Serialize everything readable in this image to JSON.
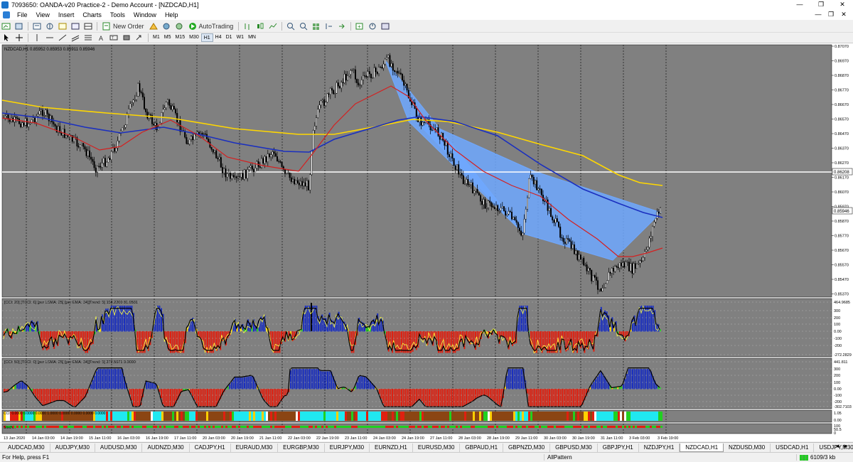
{
  "window": {
    "title": "7093650: OANDA-v20 Practice-2 - Demo Account - [NZDCAD,H1]",
    "controls": [
      "—",
      "❐",
      "✕"
    ]
  },
  "menu": {
    "items": [
      "File",
      "View",
      "Insert",
      "Charts",
      "Tools",
      "Window",
      "Help"
    ],
    "right_controls": [
      "—",
      "❐",
      "✕"
    ]
  },
  "toolbar": {
    "new_order": "New Order",
    "autotrading": "AutoTrading"
  },
  "timeframes": [
    "M1",
    "M5",
    "M15",
    "M30",
    "H1",
    "H4",
    "D1",
    "W1",
    "MN"
  ],
  "chart": {
    "header": "NZDCAD,H1  0.85952 0.85953 0.85911 0.85946",
    "price_labels": [
      "0.87070",
      "0.86970",
      "0.86870",
      "0.86770",
      "0.86670",
      "0.86570",
      "0.86470",
      "0.86370",
      "0.86270",
      "0.86170",
      "0.86070",
      "0.85970",
      "0.85870",
      "0.85770",
      "0.85670",
      "0.85570",
      "0.85470",
      "0.85370"
    ],
    "hline_label": "0.86208",
    "current_price_label": "0.85946",
    "colors": {
      "background": "#808080",
      "candle": "#000000",
      "ma_red": "#d42020",
      "ma_blue": "#1a2fbf",
      "ma_yellow": "#ffd700",
      "pattern_fill": "#6fa8ff",
      "hline": "#ffffff",
      "grid": "#000000"
    },
    "cci1_header": "[CCI: 20] [TCCI: 6] [per LSMA: 25] [per EMA: 34][Trend: 5]  158.2200 81.9581",
    "cci1_labels": [
      "464.9685",
      "300",
      "200",
      "100",
      "0.00",
      "-100",
      "-200",
      "-272.2829"
    ],
    "cci2_header": "[CCI: 50] [TCCI: 0] [per LSMA: 25] [per EMA: 34][Trend: 5]  272.5671 0.0000",
    "cci2_labels": [
      "441.811",
      "300",
      "200",
      "100",
      "0.00",
      "-100",
      "-200",
      "-302.7103"
    ],
    "sub3_header": "CCI: 0.0000 0.0000 0.0000 1.0000 0.0000 0.0000 0.0000 0.0000",
    "sub3_labels": [
      "1.05",
      "0.00"
    ],
    "sub4_header": "Stoch...",
    "sub4_labels": [
      "100",
      "50.5",
      "0"
    ],
    "time_labels": [
      "13 Jan 2020",
      "14 Jan 03:00",
      "14 Jan 19:00",
      "15 Jan 11:00",
      "16 Jan 03:00",
      "16 Jan 19:00",
      "17 Jan 11:00",
      "20 Jan 03:00",
      "20 Jan 19:00",
      "21 Jan 11:00",
      "22 Jan 03:00",
      "22 Jan 19:00",
      "23 Jan 11:00",
      "24 Jan 03:00",
      "24 Jan 19:00",
      "27 Jan 11:00",
      "28 Jan 03:00",
      "28 Jan 19:00",
      "29 Jan 11:00",
      "30 Jan 03:00",
      "30 Jan 19:00",
      "31 Jan 11:00",
      "3 Feb 03:00",
      "3 Feb 19:00"
    ]
  },
  "tabs": {
    "items": [
      "AUDCAD,M30",
      "AUDJPY,M30",
      "AUDUSD,M30",
      "AUDNZD,M30",
      "CADJPY,H1",
      "EURAUD,M30",
      "EURGBP,M30",
      "EURJPY,M30",
      "EURNZD,H1",
      "EURUSD,M30",
      "GBPAUD,H1",
      "GBPNZD,M30",
      "GBPUSD,M30",
      "GBPJPY,H1",
      "NZDJPY,H1",
      "NZDCAD,H1",
      "NZDUSD,M30",
      "USDCAD,H1",
      "USDJPY,M30"
    ],
    "active": "NZDCAD,H1",
    "nav": [
      "◄",
      "►"
    ]
  },
  "status": {
    "help": "For Help, press F1",
    "profile": "AllPattern",
    "traffic": "6109/3 kb"
  }
}
